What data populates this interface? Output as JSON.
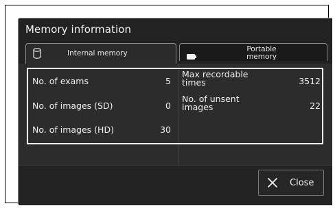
{
  "dialog": {
    "title": "Memory information"
  },
  "tabs": [
    {
      "label": "Internal memory",
      "icon": "database-icon",
      "selected": true
    },
    {
      "label": "Portable memory",
      "icon": "memory-card-icon",
      "selected": false
    }
  ],
  "left_rows": [
    {
      "label": "No. of exams",
      "value": "5"
    },
    {
      "label": "No. of images (SD)",
      "value": "0"
    },
    {
      "label": "No. of images (HD)",
      "value": "30"
    }
  ],
  "right_rows": [
    {
      "label": "Max recordable times",
      "value": "3512"
    },
    {
      "label": "No. of unsent images",
      "value": "22"
    }
  ],
  "close_button": {
    "label": "Close",
    "icon": "close-icon"
  },
  "colors": {
    "background": "#222222",
    "panel": "#2c2c2c",
    "highlight_border": "#ffffff",
    "text": "#f0f0f0"
  }
}
